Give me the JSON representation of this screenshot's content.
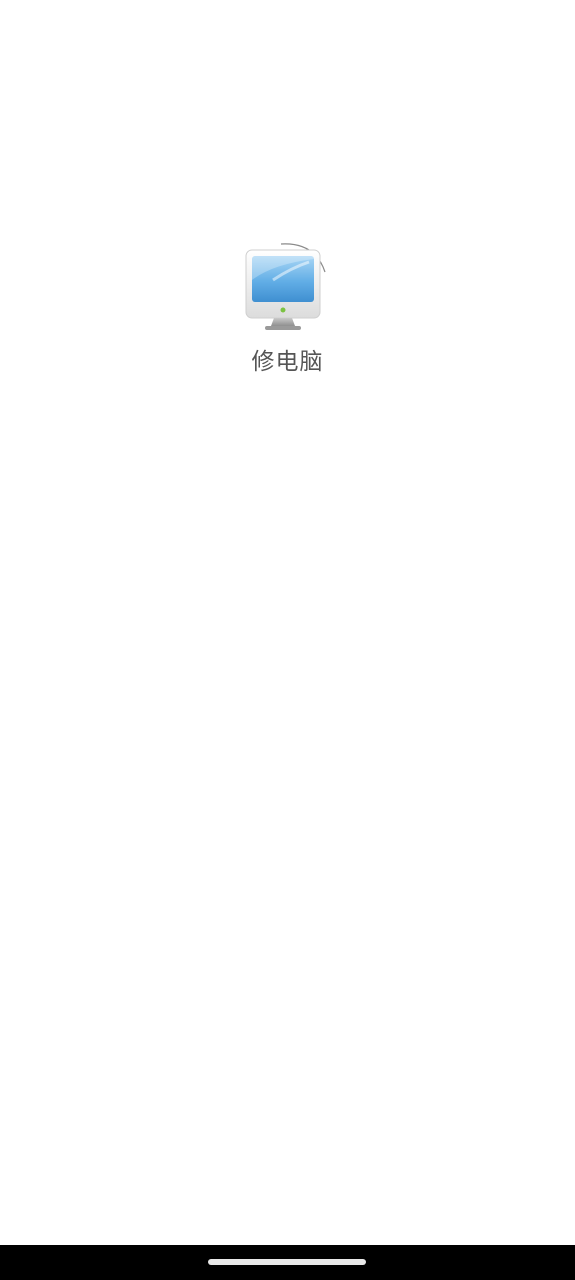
{
  "splash": {
    "app_name": "修电脑",
    "icon": "computer-monitor-icon"
  },
  "navigation_bar": {
    "background": "#000000",
    "home_indicator": "home-indicator"
  }
}
